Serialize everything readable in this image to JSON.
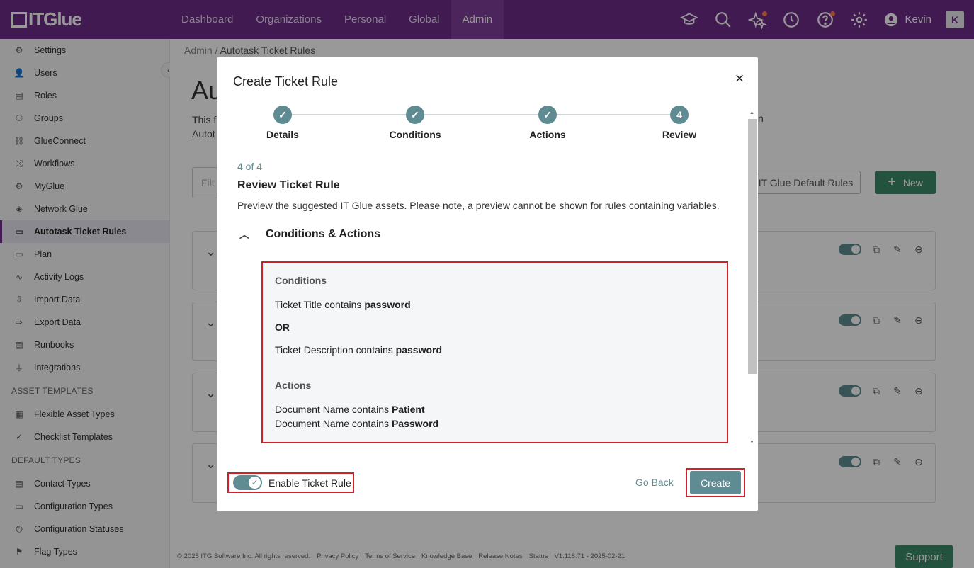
{
  "topbar": {
    "logo": "ITGlue",
    "nav": [
      "Dashboard",
      "Organizations",
      "Personal",
      "Global",
      "Admin"
    ],
    "active_nav": "Admin",
    "user": "Kevin",
    "k_badge": "K"
  },
  "sidebar": {
    "items": [
      {
        "label": "Settings",
        "icon": "gear-icon"
      },
      {
        "label": "Users",
        "icon": "user-icon"
      },
      {
        "label": "Roles",
        "icon": "roles-icon"
      },
      {
        "label": "Groups",
        "icon": "groups-icon"
      },
      {
        "label": "GlueConnect",
        "icon": "connect-icon"
      },
      {
        "label": "Workflows",
        "icon": "workflow-icon"
      },
      {
        "label": "MyGlue",
        "icon": "myglue-icon"
      },
      {
        "label": "Network Glue",
        "icon": "network-icon"
      },
      {
        "label": "Autotask Ticket Rules",
        "icon": "ticket-icon"
      },
      {
        "label": "Plan",
        "icon": "plan-icon"
      },
      {
        "label": "Activity Logs",
        "icon": "activity-icon"
      },
      {
        "label": "Import Data",
        "icon": "import-icon"
      },
      {
        "label": "Export Data",
        "icon": "export-icon"
      },
      {
        "label": "Runbooks",
        "icon": "runbook-icon"
      },
      {
        "label": "Integrations",
        "icon": "plug-icon"
      }
    ],
    "section_asset": "ASSET TEMPLATES",
    "asset_items": [
      {
        "label": "Flexible Asset Types",
        "icon": "grid-icon"
      },
      {
        "label": "Checklist Templates",
        "icon": "checklist-icon"
      }
    ],
    "section_default": "DEFAULT TYPES",
    "default_items": [
      {
        "label": "Contact Types",
        "icon": "contact-icon"
      },
      {
        "label": "Configuration Types",
        "icon": "monitor-icon"
      },
      {
        "label": "Configuration Statuses",
        "icon": "power-icon"
      },
      {
        "label": "Flag Types",
        "icon": "flag-icon"
      }
    ]
  },
  "main": {
    "breadcrumb_root": "Admin",
    "breadcrumb_sep": "/",
    "breadcrumb_current": "Autotask Ticket Rules",
    "title_fragment": "Au",
    "desc_line1": "This f",
    "desc_line1_end": "n",
    "desc_line2": "Autot",
    "filter_placeholder": "Filt",
    "default_rules_btn": "IT Glue Default Rules",
    "new_btn": "New"
  },
  "footer": {
    "copyright": "© 2025 ITG Software Inc. All rights reserved.",
    "links": [
      "Privacy Policy",
      "Terms of Service",
      "Knowledge Base",
      "Release Notes",
      "Status"
    ],
    "version": "V1.118.71 - 2025-02-21",
    "support": "Support"
  },
  "modal": {
    "title": "Create Ticket Rule",
    "steps": [
      "Details",
      "Conditions",
      "Actions",
      "Review"
    ],
    "current_step_number": "4",
    "step_count": "4 of 4",
    "review_title": "Review Ticket Rule",
    "review_desc": "Preview the suggested IT Glue assets. Please note, a preview cannot be shown for rules containing variables.",
    "section_title": "Conditions & Actions",
    "conditions_label": "Conditions",
    "cond1_prefix": "Ticket Title contains",
    "cond1_value": "password",
    "or_label": "OR",
    "cond2_prefix": "Ticket Description contains",
    "cond2_value": "password",
    "actions_label": "Actions",
    "act1_prefix": "Document Name contains",
    "act1_value": "Patient",
    "act2_prefix": "Document Name contains",
    "act2_value": "Password",
    "enable_label": "Enable Ticket Rule",
    "enable_on": true,
    "go_back": "Go Back",
    "create": "Create"
  },
  "colors": {
    "brand": "#6b2c86",
    "teal": "#5f8c92",
    "green": "#3b8a6a",
    "highlight": "#d0202a"
  }
}
